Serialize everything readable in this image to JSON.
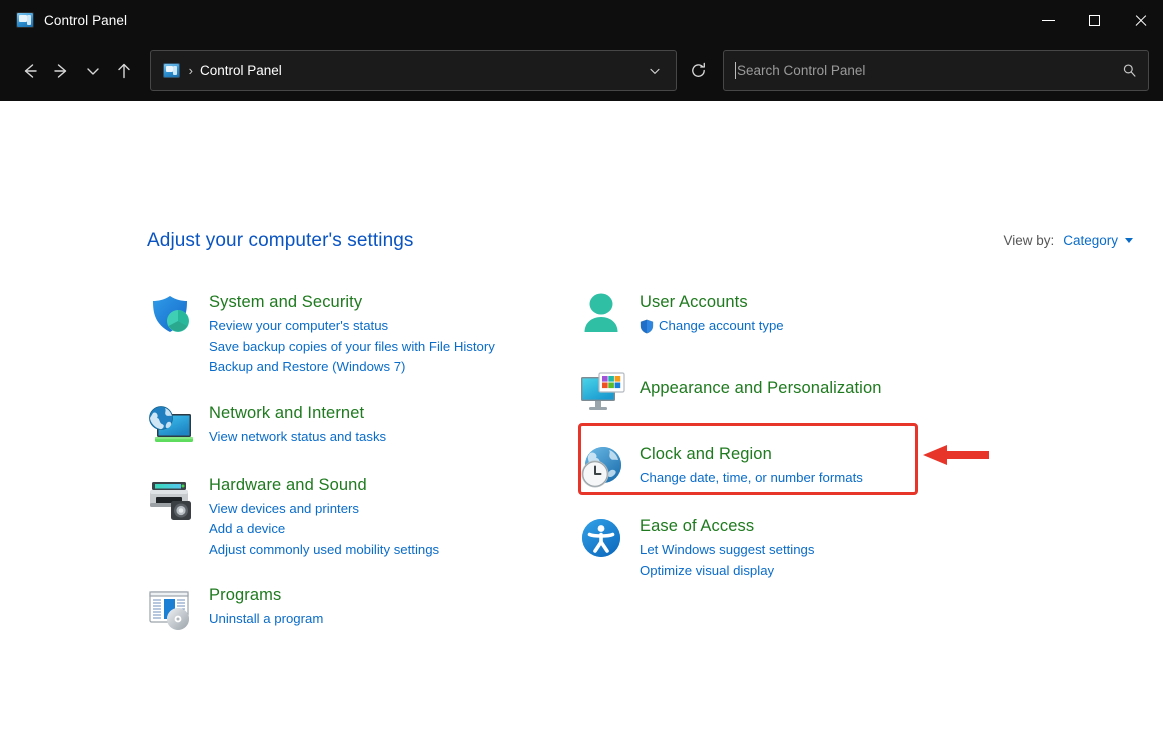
{
  "window": {
    "title": "Control Panel",
    "icon": "control-panel-icon",
    "controls": {
      "minimize": "Minimize",
      "maximize": "Maximize",
      "close": "Close"
    }
  },
  "nav": {
    "back": "Back",
    "forward": "Forward",
    "recent": "Recent locations",
    "up": "Up",
    "refresh": "Refresh",
    "address": {
      "icon": "control-panel-icon",
      "separator": "›",
      "path": "Control Panel",
      "dropdown": "Previous locations"
    },
    "search": {
      "placeholder": "Search Control Panel",
      "value": "",
      "icon": "search-icon"
    }
  },
  "main": {
    "heading": "Adjust your computer's settings",
    "view_by": {
      "label": "View by:",
      "value": "Category"
    },
    "left_column": [
      {
        "icon": "shield-icon",
        "title": "System and Security",
        "links": [
          "Review your computer's status",
          "Save backup copies of your files with File History",
          "Backup and Restore (Windows 7)"
        ]
      },
      {
        "icon": "network-globe-monitor-icon",
        "title": "Network and Internet",
        "links": [
          "View network status and tasks"
        ]
      },
      {
        "icon": "printer-icon",
        "title": "Hardware and Sound",
        "links": [
          "View devices and printers",
          "Add a device",
          "Adjust commonly used mobility settings"
        ]
      },
      {
        "icon": "programs-disc-icon",
        "title": "Programs",
        "links": [
          "Uninstall a program"
        ]
      }
    ],
    "right_column": [
      {
        "icon": "user-account-icon",
        "title": "User Accounts",
        "links": [
          "Change account type"
        ],
        "link_shield": true
      },
      {
        "icon": "appearance-monitor-icon",
        "title": "Appearance and Personalization",
        "links": []
      },
      {
        "icon": "clock-globe-icon",
        "title": "Clock and Region",
        "links": [
          "Change date, time, or number formats"
        ],
        "highlighted": true
      },
      {
        "icon": "ease-of-access-icon",
        "title": "Ease of Access",
        "links": [
          "Let Windows suggest settings",
          "Optimize visual display"
        ]
      }
    ]
  },
  "annotation": {
    "highlight_color": "#e8352a",
    "arrow_color": "#e8352a",
    "target": "Clock and Region"
  },
  "colors": {
    "titlebar_bg": "#0e0e0e",
    "heading_blue": "#0a54c2",
    "category_green": "#1f7a1f",
    "link_blue": "#0a6cc9",
    "content_bg": "#ffffff"
  }
}
